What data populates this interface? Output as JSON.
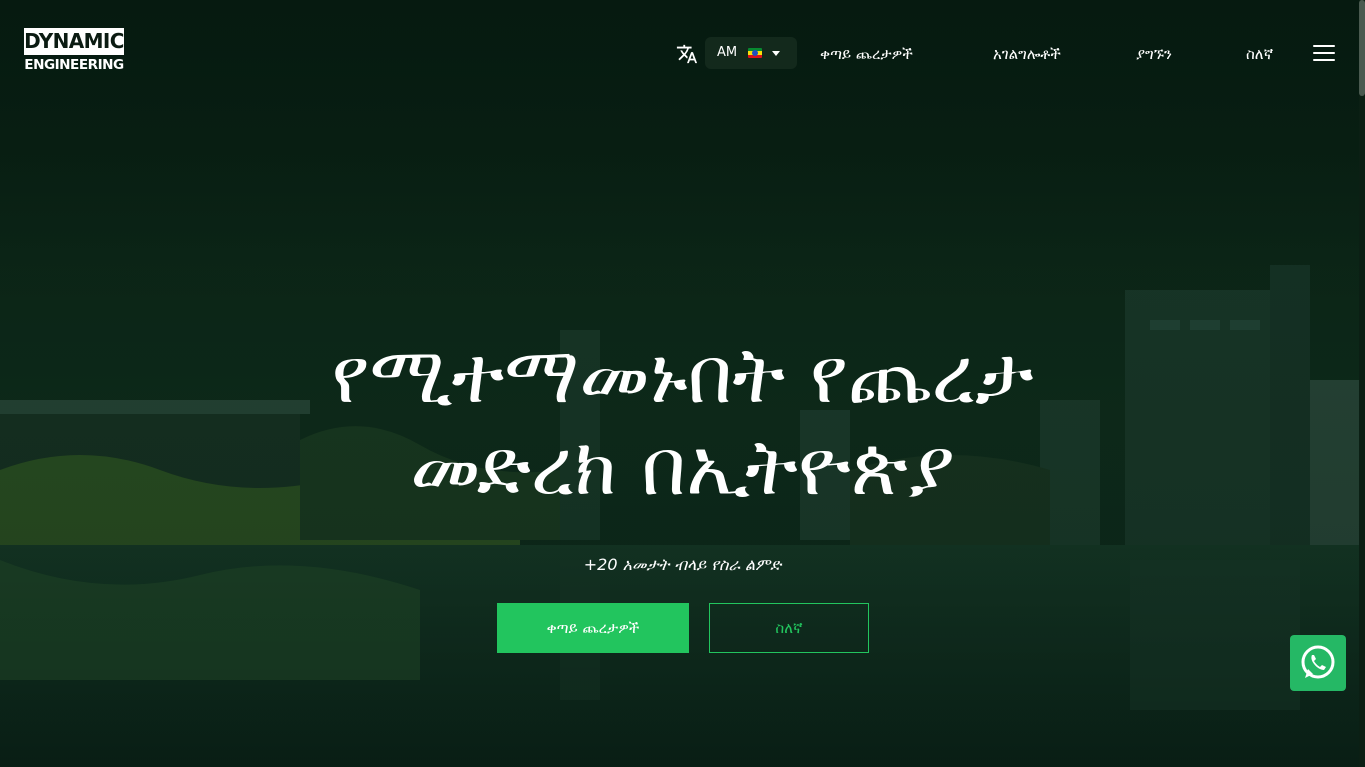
{
  "brand": {
    "logo_top": "DYNAMIC",
    "logo_bottom": "ENGINEERING"
  },
  "language": {
    "code": "AM",
    "icon": "translate-icon",
    "flag": "ethiopia-flag",
    "dropdown_icon": "chevron-down-icon"
  },
  "nav": {
    "items": [
      {
        "label": "ቀጣይ ጨረታዎች"
      },
      {
        "label": "አገልግሎቶች"
      },
      {
        "label": "ያግኙን"
      },
      {
        "label": "ስለኛ"
      }
    ],
    "menu_icon": "hamburger-menu-icon"
  },
  "hero": {
    "title_line1": "የሚተማመኑበት የጨረታ",
    "title_line2": "መድረክ በኢትዮጵያ",
    "subtitle": "+20 አመታት ብላይ የስራ ልምድ",
    "primary_button": "ቀጣይ ጨረታዎች",
    "secondary_button": "ስለኛ"
  },
  "floating": {
    "whatsapp_icon": "whatsapp-icon"
  },
  "colors": {
    "accent": "#22c55e",
    "background": "#0a2416",
    "text": "#ffffff"
  }
}
